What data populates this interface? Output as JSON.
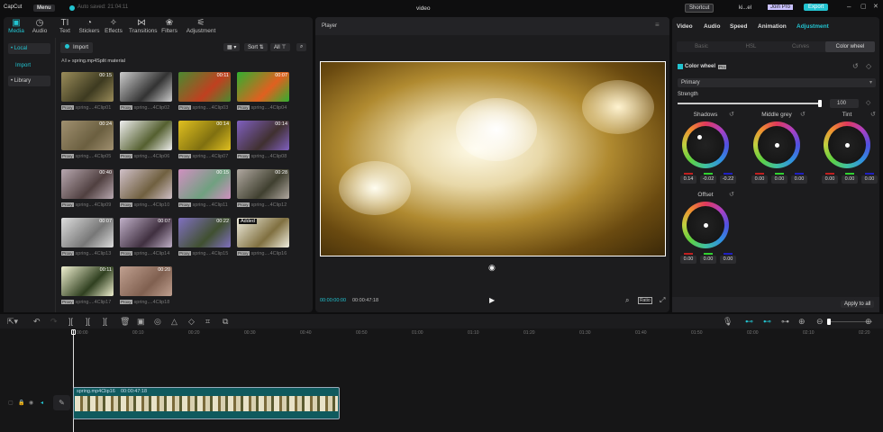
{
  "app": {
    "logo": "CapCut",
    "menu": "Menu",
    "autosave": "Auto saved: 21:04:11",
    "title": "video",
    "shortcut": "Shortcut",
    "user": "ki...el",
    "join_pro": "Join Pro",
    "export": "Export"
  },
  "toolbar_tabs": [
    {
      "label": "Media",
      "icon": "media-icon"
    },
    {
      "label": "Audio",
      "icon": "audio-icon"
    },
    {
      "label": "Text",
      "icon": "text-icon"
    },
    {
      "label": "Stickers",
      "icon": "stickers-icon"
    },
    {
      "label": "Effects",
      "icon": "effects-icon"
    },
    {
      "label": "Transitions",
      "icon": "transitions-icon"
    },
    {
      "label": "Filters",
      "icon": "filters-icon"
    },
    {
      "label": "Adjustment",
      "icon": "adjustment-icon"
    }
  ],
  "sidebar": {
    "items": [
      "• Local",
      "Import",
      "• Library"
    ]
  },
  "media": {
    "import": "Import",
    "sort": "Sort",
    "all": "All",
    "breadcrumb_root": "All",
    "breadcrumb_folder": "spring.mp4Split material",
    "proxy": "Proxy",
    "clips": [
      {
        "name": "spring....4Clip01",
        "dur": "00:15",
        "c": [
          "#9a8c5a",
          "#3d3a20"
        ]
      },
      {
        "name": "spring....4Clip02",
        "dur": "",
        "c": [
          "#ccc",
          "#333"
        ]
      },
      {
        "name": "spring....4Clip03",
        "dur": "00:11",
        "c": [
          "#4a8a30",
          "#c04020"
        ]
      },
      {
        "name": "spring....4Clip04",
        "dur": "00:07",
        "c": [
          "#30b030",
          "#e06020"
        ]
      },
      {
        "name": "spring....4Clip05",
        "dur": "00:24",
        "c": [
          "#a09070",
          "#6b5f40"
        ]
      },
      {
        "name": "spring....4Clip06",
        "dur": "",
        "c": [
          "#eee",
          "#556030"
        ]
      },
      {
        "name": "spring....4Clip07",
        "dur": "00:14",
        "c": [
          "#e0c020",
          "#807010"
        ]
      },
      {
        "name": "spring....4Clip08",
        "dur": "00:14",
        "c": [
          "#8060c0",
          "#403030"
        ]
      },
      {
        "name": "spring....4Clip09",
        "dur": "00:40",
        "c": [
          "#b8a8b0",
          "#504040"
        ]
      },
      {
        "name": "spring....4Clip10",
        "dur": "",
        "c": [
          "#d0c0c8",
          "#706040"
        ]
      },
      {
        "name": "spring....4Clip11",
        "dur": "00:15",
        "c": [
          "#d090c0",
          "#70a080"
        ]
      },
      {
        "name": "spring....4Clip12",
        "dur": "00:28",
        "c": [
          "#b0a8a0",
          "#404030"
        ]
      },
      {
        "name": "spring....4Clip13",
        "dur": "00:07",
        "c": [
          "#ddd",
          "#777"
        ]
      },
      {
        "name": "spring....4Clip14",
        "dur": "00:07",
        "c": [
          "#c0b0c8",
          "#403040"
        ]
      },
      {
        "name": "spring....4Clip15",
        "dur": "00:22",
        "c": [
          "#8070c0",
          "#405030"
        ]
      },
      {
        "name": "spring....4Clip16",
        "dur": "Added",
        "c": [
          "#f0eee0",
          "#807040"
        ]
      },
      {
        "name": "spring....4Clip17",
        "dur": "00:11",
        "c": [
          "#f0f0d0",
          "#304020"
        ]
      },
      {
        "name": "spring....4Clip18",
        "dur": "00:20",
        "c": [
          "#c0a090",
          "#806050"
        ]
      }
    ]
  },
  "player": {
    "title": "Player",
    "current": "00:00:00:00",
    "total": "00:00:47:18",
    "ratio": "Ratio"
  },
  "inspector": {
    "tabs": [
      "Video",
      "Audio",
      "Speed",
      "Animation",
      "Adjustment"
    ],
    "subtabs": [
      "Basic",
      "HSL",
      "Curves",
      "Color wheel"
    ],
    "section": "Color wheel",
    "pro": "Pro",
    "mode": "Primary",
    "strength_label": "Strength",
    "strength": "100",
    "strength_fraction": 1.0,
    "wheels": [
      {
        "name": "Shadows",
        "values": [
          "0.14",
          "-0.02",
          "-0.22"
        ]
      },
      {
        "name": "Middle grey",
        "values": [
          "0.00",
          "0.00",
          "0.00"
        ]
      },
      {
        "name": "Tint",
        "values": [
          "0.00",
          "0.00",
          "0.00"
        ]
      },
      {
        "name": "Offset",
        "values": [
          "0.00",
          "0.00",
          "0.00"
        ]
      }
    ],
    "apply_all": "Apply to all"
  },
  "timeline": {
    "ticks": [
      "00:00",
      "00:10",
      "00:20",
      "00:30",
      "00:40",
      "00:50",
      "01:00",
      "01:10",
      "01:20",
      "01:30",
      "01:40",
      "01:50",
      "02:00",
      "02:10",
      "02:20"
    ],
    "clip_name": "spring.mp4Clip16",
    "clip_dur": "00:00:47:18"
  },
  "colors": {
    "accent": "#22c3d0",
    "clip": "#0f5a5e",
    "pro": "#c9c0ff"
  }
}
